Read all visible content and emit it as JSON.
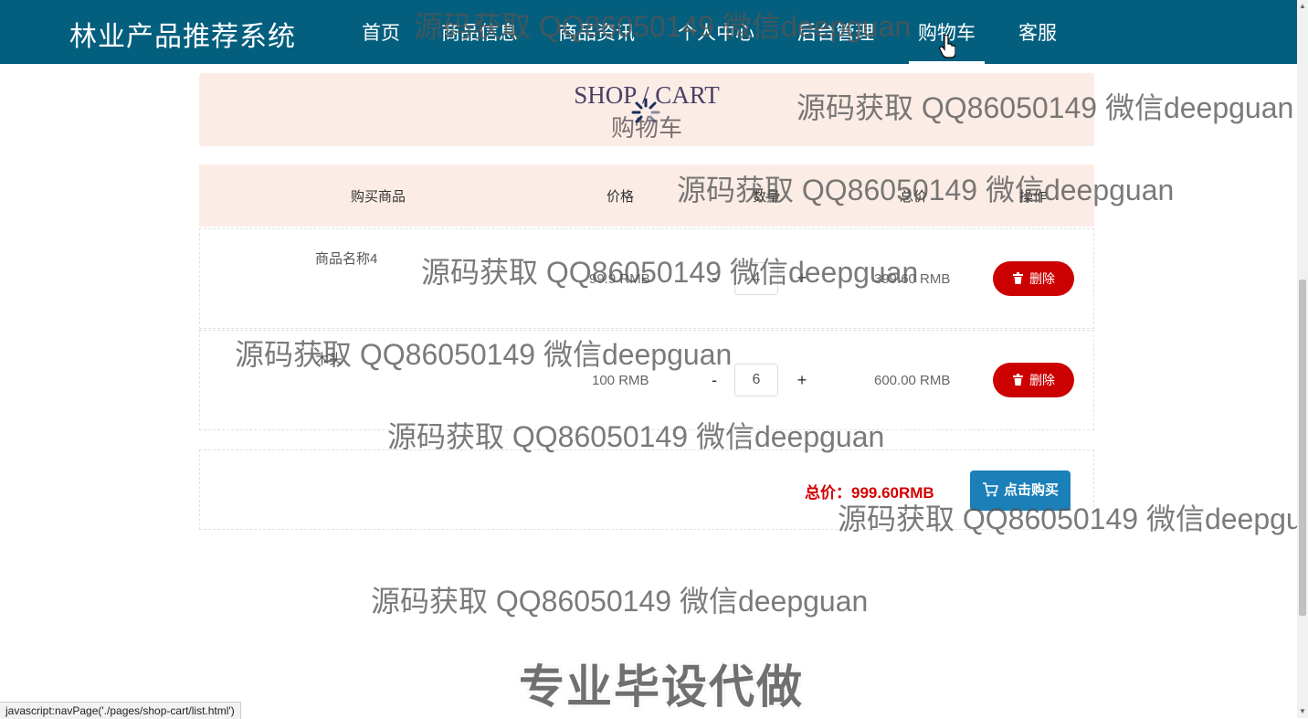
{
  "nav": {
    "brand": "林业产品推荐系统",
    "items": [
      {
        "label": "首页"
      },
      {
        "label": "商品信息"
      },
      {
        "label": "商品资讯"
      },
      {
        "label": "个人中心"
      },
      {
        "label": "后台管理"
      },
      {
        "label": "购物车"
      },
      {
        "label": "客服"
      }
    ],
    "active": "购物车"
  },
  "banner": {
    "title_en": "SHOP / CART",
    "title_cn": "购物车"
  },
  "table": {
    "headers": [
      "购买商品",
      "价格",
      "数量",
      "总价",
      "操作"
    ],
    "rows": [
      {
        "name": "商品名称4",
        "price": "99.9 RMB",
        "qty": "4",
        "total": "399.60 RMB",
        "delete_label": "删除",
        "minus": "-",
        "plus": "+"
      },
      {
        "name": "木头",
        "price": "100 RMB",
        "qty": "6",
        "total": "600.00 RMB",
        "delete_label": "删除",
        "minus": "-",
        "plus": "+"
      }
    ]
  },
  "summary": {
    "total_label": "总价：999.60RMB",
    "buy_label": "点击购买"
  },
  "watermarks": {
    "text": "源码获取 QQ86050149 微信deepguan",
    "cut_text": "源码获取 QQ86050149 微信deepgua",
    "big": "专业毕设代做"
  },
  "status_bar": "javascript:navPage('./pages/shop-cart/list.html')",
  "colors": {
    "nav_bg": "#045f7e",
    "band_bg": "#fbede6",
    "delete_red": "#cc0000",
    "buy_blue": "#1b80b8",
    "total_red": "#d40000"
  }
}
